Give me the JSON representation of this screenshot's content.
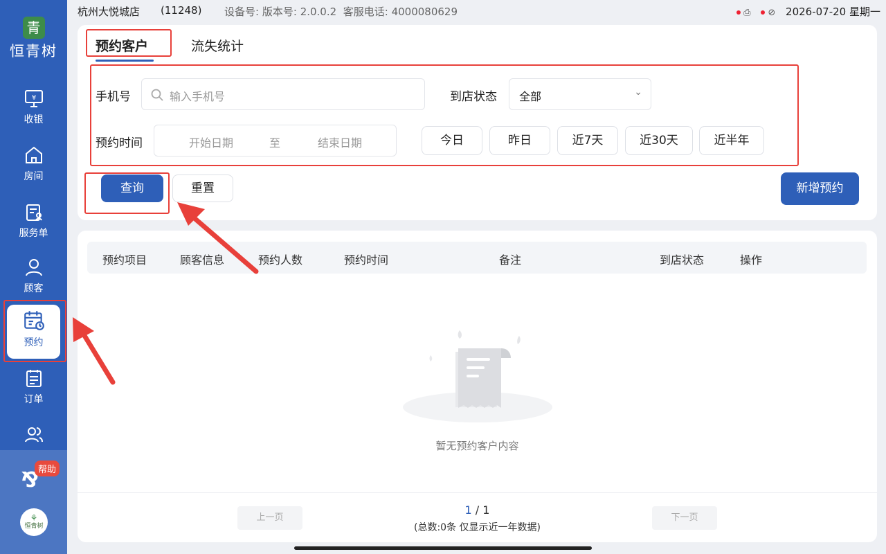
{
  "status_bar": {
    "store_name": "杭州大悦城店",
    "store_id": "(11248)",
    "device_label": "设备号:",
    "version_label": "版本号:",
    "version": "2.0.0.2",
    "hotline_label": "客服电话:",
    "hotline": "4000080629",
    "datetime": "2026-07-20 星期一"
  },
  "sidebar": {
    "logo_mark": "青",
    "logo_text": "恒青树",
    "items": [
      {
        "label": "收银",
        "icon": "cashier-icon"
      },
      {
        "label": "房间",
        "icon": "home-icon"
      },
      {
        "label": "服务单",
        "icon": "service-order-icon"
      },
      {
        "label": "顾客",
        "icon": "customer-icon"
      },
      {
        "label": "预约",
        "icon": "calendar-icon",
        "active": true
      },
      {
        "label": "订单",
        "icon": "order-icon"
      },
      {
        "label": "",
        "icon": "staff-icon"
      }
    ],
    "help_badge": "帮助",
    "avatar_text": "恒青树"
  },
  "tabs": [
    {
      "label": "预约客户",
      "active": true
    },
    {
      "label": "流失统计",
      "active": false
    }
  ],
  "filters": {
    "phone_label": "手机号",
    "phone_placeholder": "输入手机号",
    "status_label": "到店状态",
    "status_value": "全部",
    "time_label": "预约时间",
    "start_placeholder": "开始日期",
    "range_sep": "至",
    "end_placeholder": "结束日期",
    "quick_ranges": [
      "今日",
      "昨日",
      "近7天",
      "近30天",
      "近半年"
    ]
  },
  "actions": {
    "query": "查询",
    "reset": "重置",
    "add": "新增预约"
  },
  "table": {
    "columns": [
      "预约项目",
      "顾客信息",
      "预约人数",
      "预约时间",
      "备注",
      "到店状态",
      "操作"
    ],
    "empty_text": "暂无预约客户内容"
  },
  "pagination": {
    "prev": "上一页",
    "next": "下一页",
    "current": "1",
    "sep": " / ",
    "total_pages": "1",
    "summary": "(总数:0条 仅显示近一年数据)"
  },
  "colors": {
    "primary": "#2e5fb8",
    "annotation": "#e8403a"
  }
}
